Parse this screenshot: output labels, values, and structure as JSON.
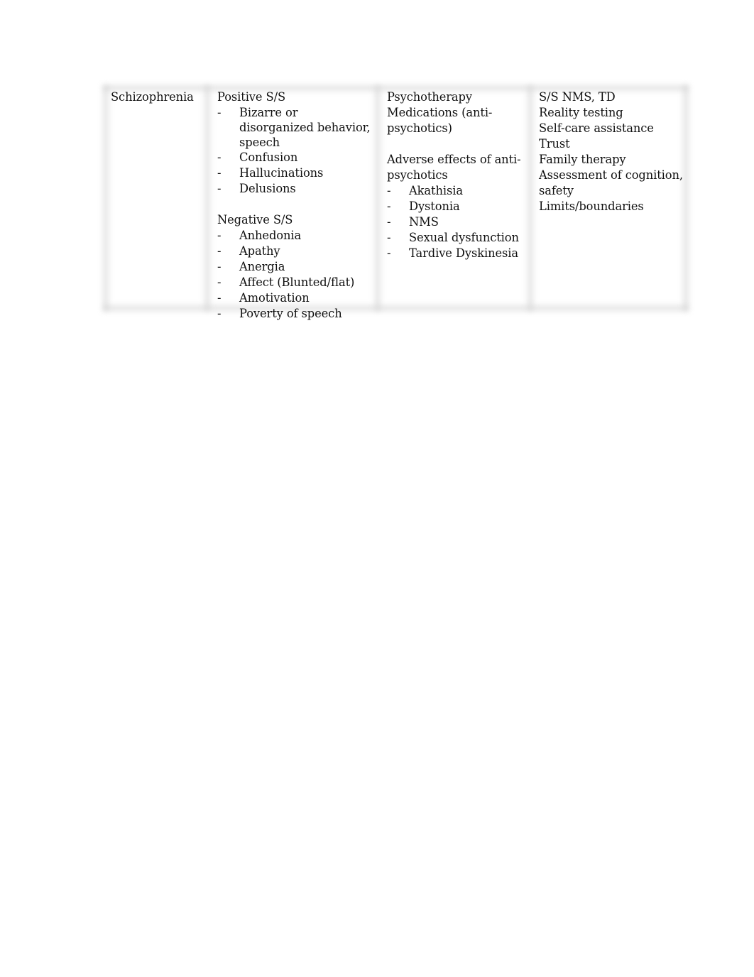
{
  "document": {
    "table": {
      "row": {
        "condition": "Schizophrenia",
        "symptoms": {
          "positive_heading": "Positive S/S",
          "positive_items": [
            "Bizarre or disorganized behavior, speech",
            "Confusion",
            "Hallucinations",
            "Delusions"
          ],
          "negative_heading": "Negative S/S",
          "negative_items": [
            "Anhedonia",
            "Apathy",
            "Anergia",
            "Affect (Blunted/flat)",
            "Amotivation",
            "Poverty of speech"
          ]
        },
        "treatment": {
          "lines": [
            "Psychotherapy",
            "Medications (anti-psychotics)"
          ],
          "adverse_heading": "Adverse effects of anti-psychotics",
          "adverse_items": [
            "Akathisia",
            "Dystonia",
            "NMS",
            "Sexual dysfunction",
            "Tardive Dyskinesia"
          ]
        },
        "nursing": {
          "items": [
            "S/S NMS, TD",
            "Reality testing",
            "Self-care assistance",
            "Trust",
            "Family therapy",
            "Assessment of cognition, safety",
            "Limits/boundaries"
          ]
        }
      },
      "bullet_marker": "-"
    }
  }
}
